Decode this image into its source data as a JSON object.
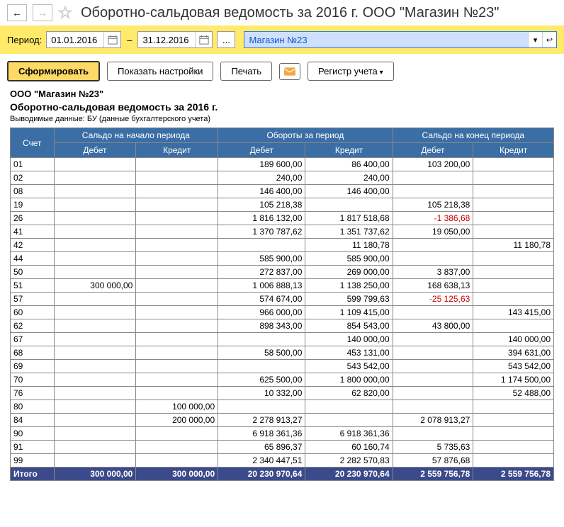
{
  "header": {
    "title": "Оборотно-сальдовая ведомость за 2016 г. ООО \"Магазин №23\""
  },
  "period": {
    "label": "Период:",
    "from": "01.01.2016",
    "to": "31.12.2016",
    "dots": "...",
    "org": "Магазин №23"
  },
  "actions": {
    "form": "Сформировать",
    "settings": "Показать настройки",
    "print": "Печать",
    "register": "Регистр учета"
  },
  "report": {
    "org": "ООО \"Магазин №23\"",
    "title": "Оборотно-сальдовая ведомость за 2016 г.",
    "sub": "Выводимые данные:  БУ (данные бухгалтерского учета)",
    "headers": {
      "account": "Счет",
      "openBal": "Сальдо на начало периода",
      "turnover": "Обороты за период",
      "closeBal": "Сальдо на конец периода",
      "debit": "Дебет",
      "credit": "Кредит"
    },
    "rows": [
      {
        "acc": "01",
        "obd": "",
        "obc": "",
        "td": "189 600,00",
        "tc": "86 400,00",
        "cbd": "103 200,00",
        "cbc": ""
      },
      {
        "acc": "02",
        "obd": "",
        "obc": "",
        "td": "240,00",
        "tc": "240,00",
        "cbd": "",
        "cbc": ""
      },
      {
        "acc": "08",
        "obd": "",
        "obc": "",
        "td": "146 400,00",
        "tc": "146 400,00",
        "cbd": "",
        "cbc": ""
      },
      {
        "acc": "19",
        "obd": "",
        "obc": "",
        "td": "105 218,38",
        "tc": "",
        "cbd": "105 218,38",
        "cbc": ""
      },
      {
        "acc": "26",
        "obd": "",
        "obc": "",
        "td": "1 816 132,00",
        "tc": "1 817 518,68",
        "cbd": "-1 386,68",
        "cbd_neg": true,
        "cbc": ""
      },
      {
        "acc": "41",
        "obd": "",
        "obc": "",
        "td": "1 370 787,62",
        "tc": "1 351 737,62",
        "cbd": "19 050,00",
        "cbc": ""
      },
      {
        "acc": "42",
        "obd": "",
        "obc": "",
        "td": "",
        "tc": "11 180,78",
        "cbd": "",
        "cbc": "11 180,78"
      },
      {
        "acc": "44",
        "obd": "",
        "obc": "",
        "td": "585 900,00",
        "tc": "585 900,00",
        "cbd": "",
        "cbc": ""
      },
      {
        "acc": "50",
        "obd": "",
        "obc": "",
        "td": "272 837,00",
        "tc": "269 000,00",
        "cbd": "3 837,00",
        "cbc": ""
      },
      {
        "acc": "51",
        "obd": "300 000,00",
        "obc": "",
        "td": "1 006 888,13",
        "tc": "1 138 250,00",
        "cbd": "168 638,13",
        "cbc": ""
      },
      {
        "acc": "57",
        "obd": "",
        "obc": "",
        "td": "574 674,00",
        "tc": "599 799,63",
        "cbd": "-25 125,63",
        "cbd_neg": true,
        "cbc": ""
      },
      {
        "acc": "60",
        "obd": "",
        "obc": "",
        "td": "966 000,00",
        "tc": "1 109 415,00",
        "cbd": "",
        "cbc": "143 415,00"
      },
      {
        "acc": "62",
        "obd": "",
        "obc": "",
        "td": "898 343,00",
        "tc": "854 543,00",
        "cbd": "43 800,00",
        "cbc": ""
      },
      {
        "acc": "67",
        "obd": "",
        "obc": "",
        "td": "",
        "tc": "140 000,00",
        "cbd": "",
        "cbc": "140 000,00"
      },
      {
        "acc": "68",
        "obd": "",
        "obc": "",
        "td": "58 500,00",
        "tc": "453 131,00",
        "cbd": "",
        "cbc": "394 631,00"
      },
      {
        "acc": "69",
        "obd": "",
        "obc": "",
        "td": "",
        "tc": "543 542,00",
        "cbd": "",
        "cbc": "543 542,00"
      },
      {
        "acc": "70",
        "obd": "",
        "obc": "",
        "td": "625 500,00",
        "tc": "1 800 000,00",
        "cbd": "",
        "cbc": "1 174 500,00"
      },
      {
        "acc": "76",
        "obd": "",
        "obc": "",
        "td": "10 332,00",
        "tc": "62 820,00",
        "cbd": "",
        "cbc": "52 488,00"
      },
      {
        "acc": "80",
        "obd": "",
        "obc": "100 000,00",
        "td": "",
        "tc": "",
        "cbd": "",
        "cbc": ""
      },
      {
        "acc": "84",
        "obd": "",
        "obc": "200 000,00",
        "td": "2 278 913,27",
        "tc": "",
        "cbd": "2 078 913,27",
        "cbc": ""
      },
      {
        "acc": "90",
        "obd": "",
        "obc": "",
        "td": "6 918 361,36",
        "tc": "6 918 361,36",
        "cbd": "",
        "cbc": ""
      },
      {
        "acc": "91",
        "obd": "",
        "obc": "",
        "td": "65 896,37",
        "tc": "60 160,74",
        "cbd": "5 735,63",
        "cbc": ""
      },
      {
        "acc": "99",
        "obd": "",
        "obc": "",
        "td": "2 340 447,51",
        "tc": "2 282 570,83",
        "cbd": "57 876,68",
        "cbc": ""
      }
    ],
    "total": {
      "label": "Итого",
      "obd": "300 000,00",
      "obc": "300 000,00",
      "td": "20 230 970,64",
      "tc": "20 230 970,64",
      "cbd": "2 559 756,78",
      "cbc": "2 559 756,78"
    }
  }
}
